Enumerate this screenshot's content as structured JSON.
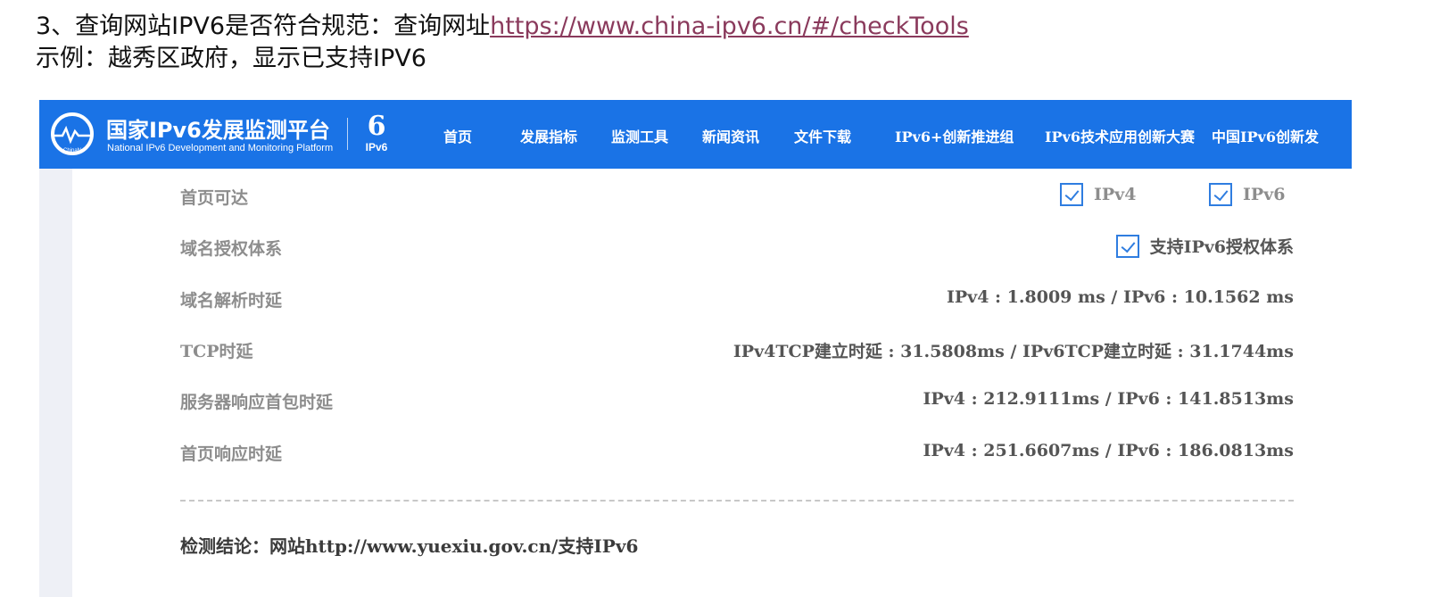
{
  "doc": {
    "line1_prefix": "3、查询网站IPV6是否符合规范：查询网址",
    "line1_link": "https://www.china-ipv6.cn/#/checkTools",
    "line2": "示例：越秀区政府，显示已支持IPV6"
  },
  "navbar": {
    "bg_color": "#1a73e6",
    "logo_title": "国家IPv6发展监测平台",
    "logo_subtitle": "National IPv6 Development and Monitoring Platform",
    "logo_circle_text": "ChinaN",
    "ipv6_mark_label": "IPv6",
    "items": [
      "首页",
      "发展指标",
      "监测工具",
      "新闻资讯",
      "文件下载",
      "IPv6+创新推进组",
      "IPv6技术应用创新大赛",
      "中国IPv6创新发"
    ]
  },
  "results": [
    {
      "label": "首页可达",
      "checkboxes": [
        "IPv4",
        "IPv6"
      ]
    },
    {
      "label": "域名授权体系",
      "checkboxes": [
        "支持IPv6授权体系"
      ]
    },
    {
      "label": "域名解析时延",
      "value": "IPv4 : 1.8009 ms / IPv6 : 10.1562 ms"
    },
    {
      "label": "TCP时延",
      "value": "IPv4TCP建立时延 : 31.5808ms / IPv6TCP建立时延 : 31.1744ms"
    },
    {
      "label": "服务器响应首包时延",
      "value": "IPv4 : 212.9111ms / IPv6 : 141.8513ms"
    },
    {
      "label": "首页响应时延",
      "value": "IPv4 : 251.6607ms / IPv6 : 186.0813ms"
    }
  ],
  "conclusion": "检测结论：网站http://www.yuexiu.gov.cn/支持IPv6",
  "icons": {
    "logo": "monitor-circle-icon",
    "checkbox": "checkbox-checked-icon"
  }
}
